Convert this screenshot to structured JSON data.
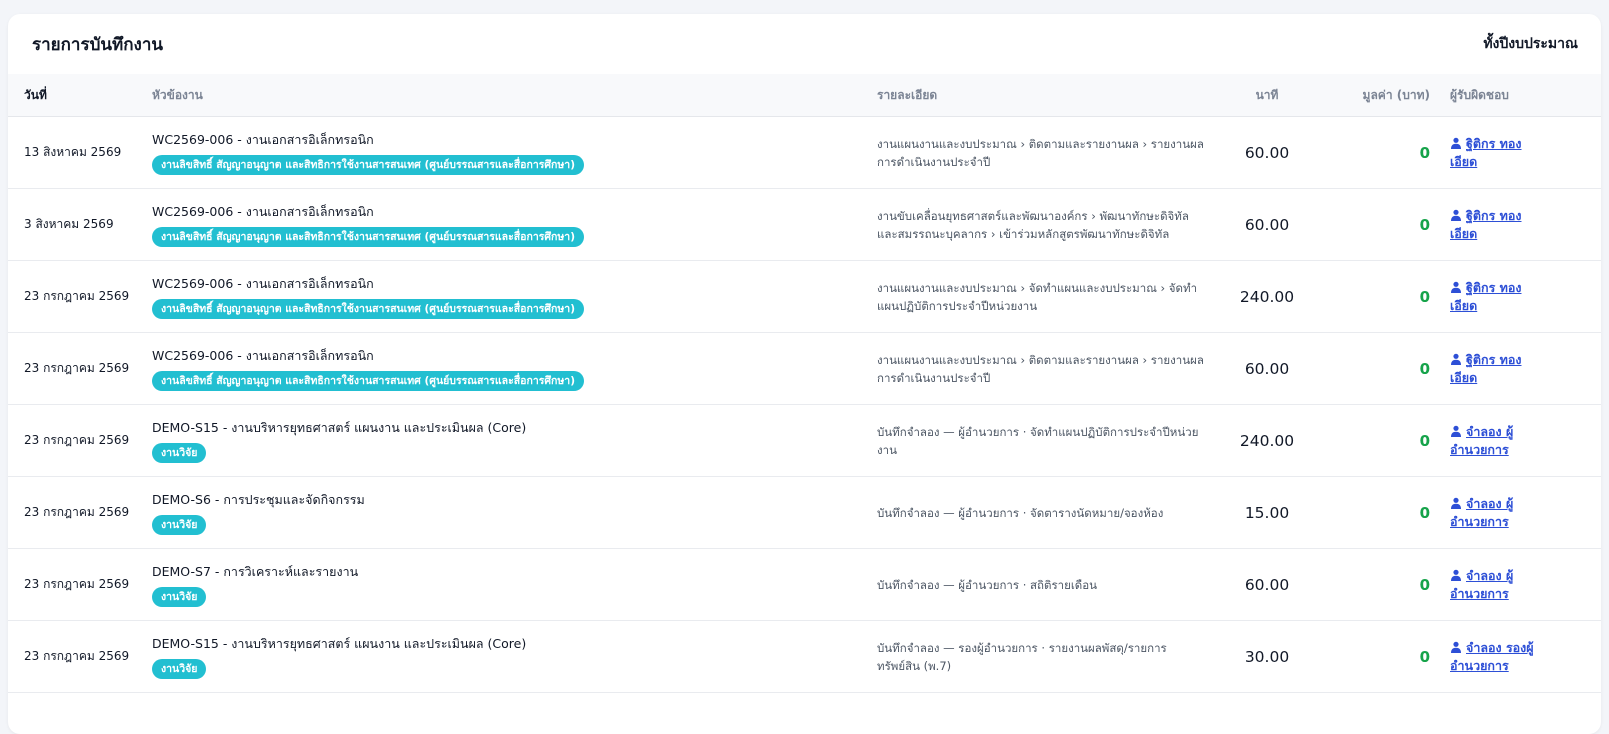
{
  "header": {
    "title": "รายการบันทึกงาน",
    "period": "ทั้งปีงบประมาณ"
  },
  "columns": {
    "date": "วันที่",
    "topic": "หัวข้องาน",
    "detail": "รายละเอียด",
    "minutes": "นาที",
    "value": "มูลค่า (บาท)",
    "owner": "ผู้รับผิดชอบ"
  },
  "rows": [
    {
      "date": "13 สิงหาคม 2569",
      "title": "WC2569-006 - งานเอกสารอิเล็กทรอนิก",
      "tag": "งานลิขสิทธิ์ สัญญาอนุญาต และสิทธิการใช้งานสารสนเทศ (ศูนย์บรรณสารและสื่อการศึกษา)",
      "detail": "งานแผนงานและงบประมาณ › ติดตามและรายงานผล › รายงานผลการดำเนินงานประจำปี",
      "minutes": "60.00",
      "value": "0",
      "owner": "ฐิติกร ทองเอียด"
    },
    {
      "date": "3 สิงหาคม 2569",
      "title": "WC2569-006 - งานเอกสารอิเล็กทรอนิก",
      "tag": "งานลิขสิทธิ์ สัญญาอนุญาต และสิทธิการใช้งานสารสนเทศ (ศูนย์บรรณสารและสื่อการศึกษา)",
      "detail": "งานขับเคลื่อนยุทธศาสตร์และพัฒนาองค์กร › พัฒนาทักษะดิจิทัลและสมรรถนะบุคลากร › เข้าร่วมหลักสูตรพัฒนาทักษะดิจิทัล",
      "minutes": "60.00",
      "value": "0",
      "owner": "ฐิติกร ทองเอียด"
    },
    {
      "date": "23 กรกฎาคม 2569",
      "title": "WC2569-006 - งานเอกสารอิเล็กทรอนิก",
      "tag": "งานลิขสิทธิ์ สัญญาอนุญาต และสิทธิการใช้งานสารสนเทศ (ศูนย์บรรณสารและสื่อการศึกษา)",
      "detail": "งานแผนงานและงบประมาณ › จัดทำแผนและงบประมาณ › จัดทำแผนปฏิบัติการประจำปีหน่วยงาน",
      "minutes": "240.00",
      "value": "0",
      "owner": "ฐิติกร ทองเอียด"
    },
    {
      "date": "23 กรกฎาคม 2569",
      "title": "WC2569-006 - งานเอกสารอิเล็กทรอนิก",
      "tag": "งานลิขสิทธิ์ สัญญาอนุญาต และสิทธิการใช้งานสารสนเทศ (ศูนย์บรรณสารและสื่อการศึกษา)",
      "detail": "งานแผนงานและงบประมาณ › ติดตามและรายงานผล › รายงานผลการดำเนินงานประจำปี",
      "minutes": "60.00",
      "value": "0",
      "owner": "ฐิติกร ทองเอียด"
    },
    {
      "date": "23 กรกฎาคม 2569",
      "title": "DEMO-S15 - งานบริหารยุทธศาสตร์ แผนงาน และประเมินผล (Core)",
      "tag": "งานวิจัย",
      "detail": "บันทึกจำลอง — ผู้อำนวยการ · จัดทำแผนปฏิบัติการประจำปีหน่วยงาน",
      "minutes": "240.00",
      "value": "0",
      "owner": "จำลอง ผู้อำนวยการ"
    },
    {
      "date": "23 กรกฎาคม 2569",
      "title": "DEMO-S6 - การประชุมและจัดกิจกรรม",
      "tag": "งานวิจัย",
      "detail": "บันทึกจำลอง — ผู้อำนวยการ · จัดตารางนัดหมาย/จองห้อง",
      "minutes": "15.00",
      "value": "0",
      "owner": "จำลอง ผู้อำนวยการ"
    },
    {
      "date": "23 กรกฎาคม 2569",
      "title": "DEMO-S7 - การวิเคราะห์และรายงาน",
      "tag": "งานวิจัย",
      "detail": "บันทึกจำลอง — ผู้อำนวยการ · สถิติรายเดือน",
      "minutes": "60.00",
      "value": "0",
      "owner": "จำลอง ผู้อำนวยการ"
    },
    {
      "date": "23 กรกฎาคม 2569",
      "title": "DEMO-S15 - งานบริหารยุทธศาสตร์ แผนงาน และประเมินผล (Core)",
      "tag": "งานวิจัย",
      "detail": "บันทึกจำลอง — รองผู้อำนวยการ · รายงานผลพัสดุ/รายการทรัพย์สิน (พ.7)",
      "minutes": "30.00",
      "value": "0",
      "owner": "จำลอง รองผู้อำนวยการ"
    }
  ]
}
